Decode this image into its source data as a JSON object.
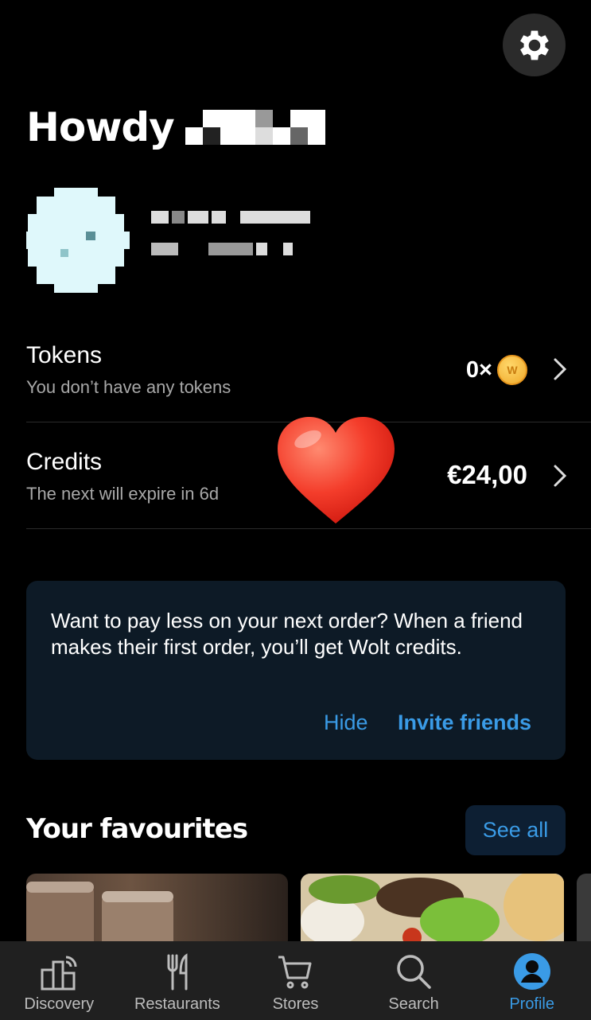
{
  "greeting": {
    "prefix": "Howdy"
  },
  "tokens": {
    "title": "Tokens",
    "subtitle": "You don’t have any tokens",
    "value": "0×",
    "coin_letter": "W"
  },
  "credits": {
    "title": "Credits",
    "subtitle": "The next will expire in 6d",
    "value": "€24,00"
  },
  "promo": {
    "text": "Want to pay less on your next order? When a friend makes their first order, you’ll get Wolt credits.",
    "hide_label": "Hide",
    "invite_label": "Invite friends"
  },
  "favourites": {
    "title": "Your favourites",
    "see_all_label": "See all"
  },
  "tabs": [
    {
      "label": "Discovery",
      "icon": "discovery-icon"
    },
    {
      "label": "Restaurants",
      "icon": "cutlery-icon"
    },
    {
      "label": "Stores",
      "icon": "cart-icon"
    },
    {
      "label": "Search",
      "icon": "search-icon"
    },
    {
      "label": "Profile",
      "icon": "profile-icon"
    }
  ],
  "colors": {
    "accent": "#3a9be6",
    "background": "#000000",
    "card": "#0d1a26"
  }
}
